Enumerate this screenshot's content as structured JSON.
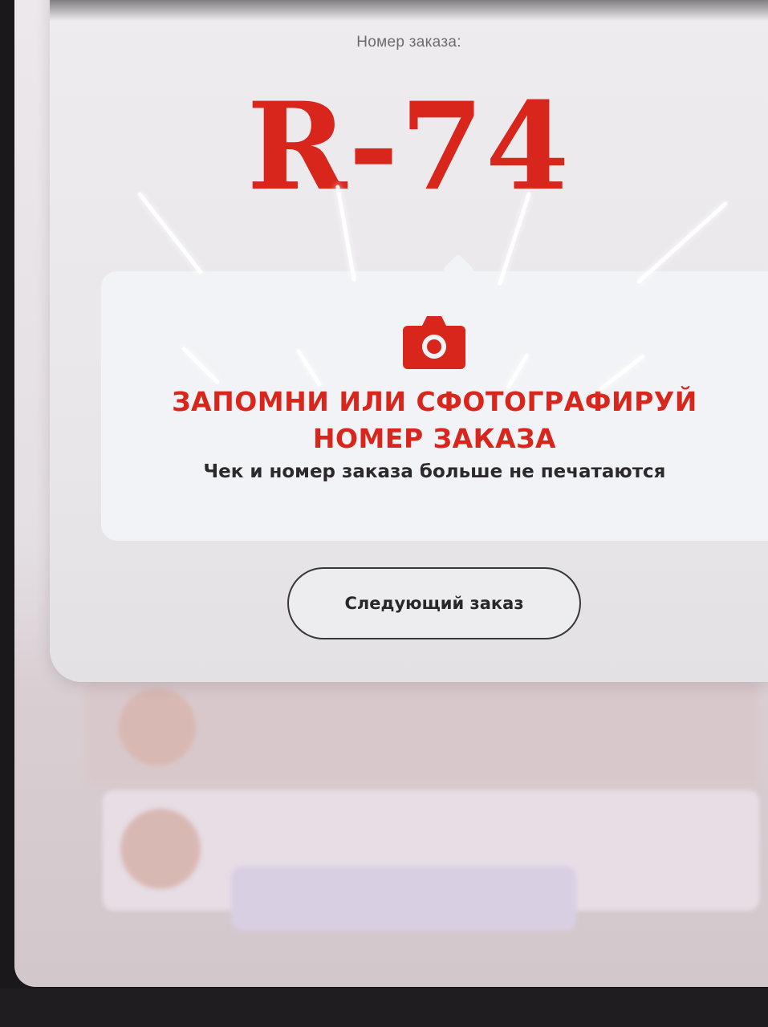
{
  "dialog": {
    "order_label": "Номер заказа:",
    "order_number": "R-74",
    "callout": {
      "icon": "camera-icon",
      "headline_line1": "ЗАПОМНИ ИЛИ СФОТОГРАФИРУЙ",
      "headline_line2": "НОМЕР ЗАКАЗА",
      "subtext": "Чек и номер заказа больше не печатаются"
    },
    "next_button_label": "Следующий заказ"
  },
  "colors": {
    "accent": "#d8261c",
    "text_dark": "#2c292c",
    "screen_bg": "#ece8ec"
  }
}
